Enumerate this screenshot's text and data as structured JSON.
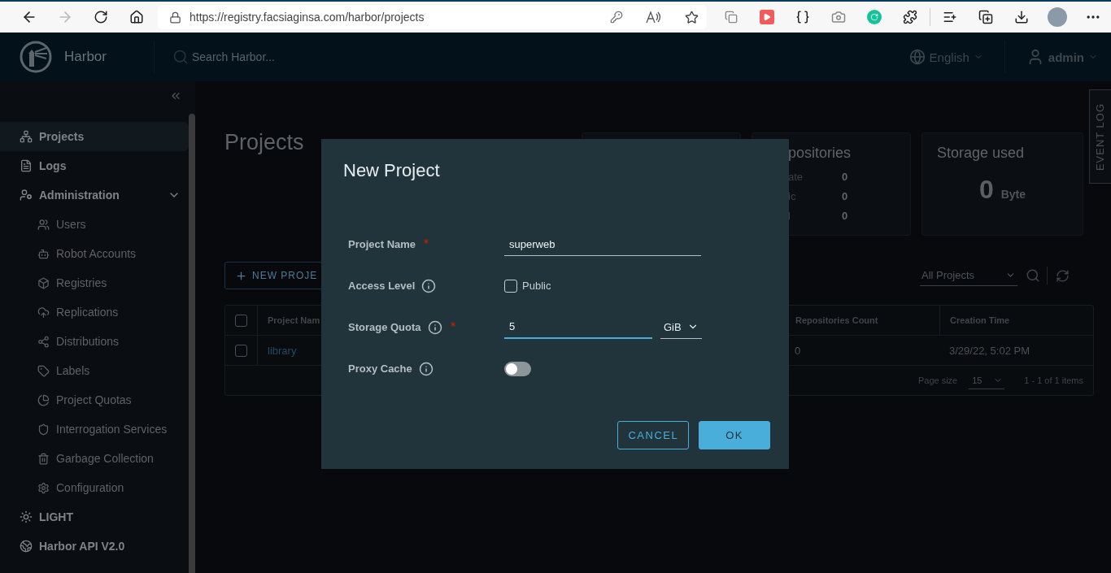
{
  "browser": {
    "url": "https://registry.facsiaginsa.com/harbor/projects"
  },
  "header": {
    "app_name": "Harbor",
    "search": {
      "placeholder": "Search Harbor..."
    },
    "language": "English",
    "user": "admin"
  },
  "sidebar": {
    "items": [
      {
        "label": "Projects",
        "selected": true
      },
      {
        "label": "Logs",
        "selected": false
      },
      {
        "label": "Administration",
        "selected": false,
        "expanded": true,
        "children": [
          {
            "label": "Users",
            "selected": false
          },
          {
            "label": "Robot Accounts",
            "selected": false
          },
          {
            "label": "Registries",
            "selected": false
          },
          {
            "label": "Replications",
            "selected": false
          },
          {
            "label": "Distributions",
            "selected": false
          },
          {
            "label": "Labels",
            "selected": false
          },
          {
            "label": "Project Quotas",
            "selected": false
          },
          {
            "label": "Interrogation Services",
            "selected": false
          },
          {
            "label": "Garbage Collection",
            "selected": false
          },
          {
            "label": "Configuration",
            "selected": false
          }
        ]
      }
    ],
    "footer_items": [
      {
        "label": "LIGHT"
      },
      {
        "label": "Harbor API V2.0"
      }
    ]
  },
  "page": {
    "title": "Projects"
  },
  "stats": [
    {
      "kind": "blank"
    },
    {
      "kind": "counts",
      "title": "positories",
      "rows": [
        {
          "label": "ate",
          "value": "0"
        },
        {
          "label": "ic",
          "value": "0"
        },
        {
          "label": "l",
          "value": "0"
        }
      ]
    },
    {
      "kind": "storage",
      "title": "Storage used",
      "value": "0",
      "unit": "Byte"
    }
  ],
  "toolbar": {
    "new_button": "NEW PROJE",
    "filter": "All Projects"
  },
  "table": {
    "header_checked": false,
    "columns": [
      "Project Nam",
      "Repositories Count",
      "Creation Time"
    ],
    "rows": [
      {
        "selected": false,
        "cells": [
          "library",
          "0",
          "3/29/22, 5:02 PM"
        ]
      }
    ],
    "footer": {
      "page_size_label": "Page size",
      "page_size": "15",
      "range": "1 - 1 of 1 items"
    }
  },
  "event_log": "EVENT LOG",
  "dialog": {
    "title": "New Project",
    "fields": [
      {
        "kind": "text",
        "label": "Project Name",
        "required": true,
        "value": "superweb",
        "focused": false
      },
      {
        "kind": "checkbox",
        "label": "Access Level",
        "info": true,
        "option": "Public",
        "checked": false
      },
      {
        "kind": "quantity",
        "label": "Storage Quota",
        "required": true,
        "info": true,
        "value": "5",
        "unit": "GiB",
        "focused": true
      },
      {
        "kind": "toggle",
        "label": "Proxy Cache",
        "info": true,
        "on": false
      }
    ],
    "buttons": [
      {
        "kind": "secondary",
        "label": "CANCEL"
      },
      {
        "kind": "primary",
        "label": "OK"
      }
    ]
  }
}
